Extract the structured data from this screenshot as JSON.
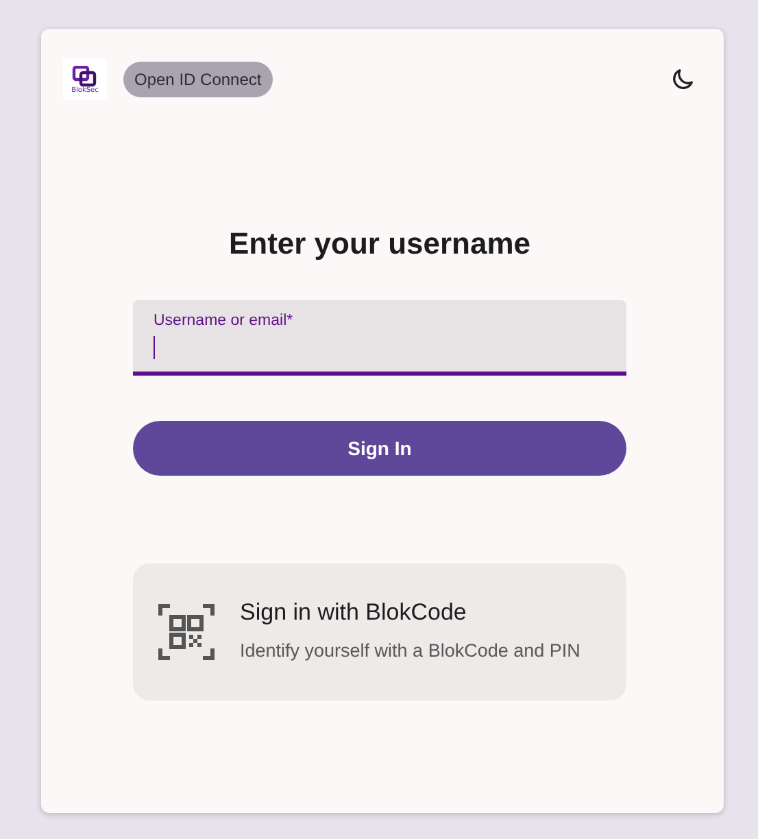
{
  "header": {
    "logo_text": "BlokSec",
    "badge": "Open ID Connect"
  },
  "title": "Enter your username",
  "field": {
    "label": "Username or email*",
    "focused": true
  },
  "sign_in_button": "Sign In",
  "alt_option": {
    "title": "Sign in with BlokCode",
    "description": "Identify yourself with a BlokCode and PIN"
  }
}
